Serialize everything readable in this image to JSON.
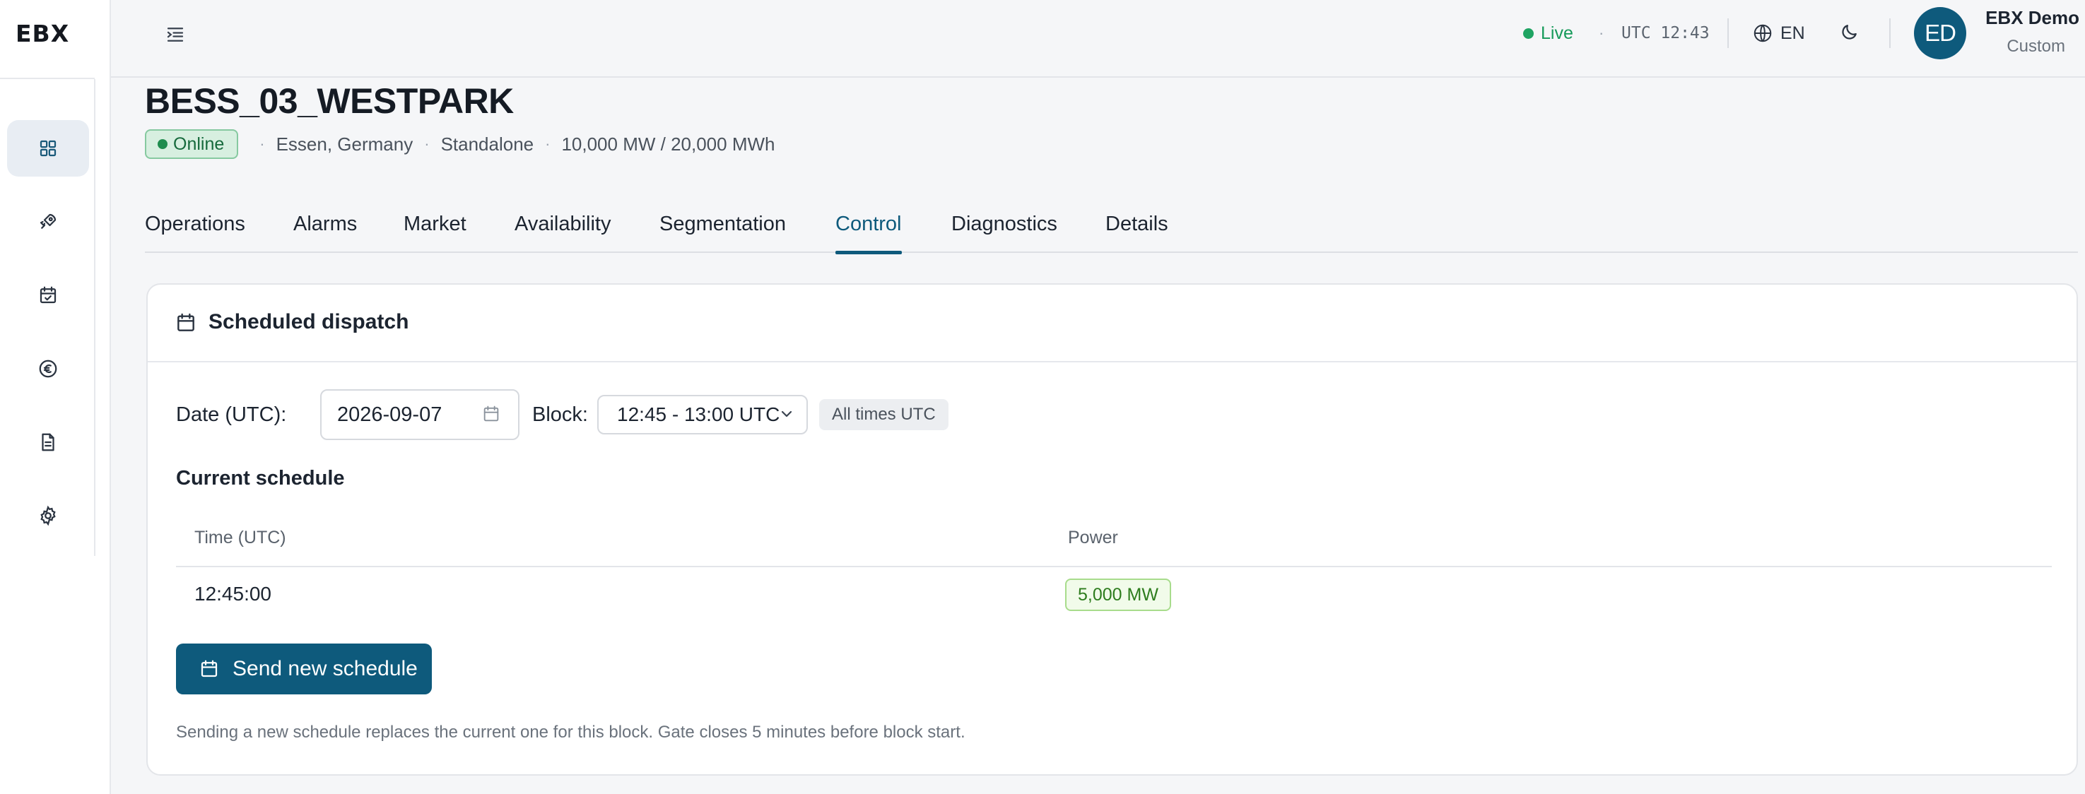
{
  "app": {
    "logo": "EBX",
    "status": {
      "live_label": "Live",
      "clock": "UTC 12:43",
      "color": "#1fa463"
    },
    "language": "EN",
    "user": {
      "initials": "ED",
      "name": "EBX Demo",
      "role": "Custom"
    },
    "accent_color": "#0e5a7c"
  },
  "sidebar": {
    "items": [
      {
        "name": "dashboard",
        "icon": "grid-icon",
        "active": true
      },
      {
        "name": "assets",
        "icon": "rocket-icon",
        "active": false
      },
      {
        "name": "schedule",
        "icon": "calendar-check-icon",
        "active": false
      },
      {
        "name": "finance",
        "icon": "euro-icon",
        "active": false
      },
      {
        "name": "reports",
        "icon": "document-icon",
        "active": false
      },
      {
        "name": "settings",
        "icon": "gear-icon",
        "active": false
      }
    ]
  },
  "asset": {
    "title": "BESS_03_WESTPARK",
    "status": "Online",
    "location": "Essen, Germany",
    "mode": "Standalone",
    "capacity": "10,000 MW / 20,000 MWh"
  },
  "tabs": [
    {
      "label": "Operations",
      "active": false
    },
    {
      "label": "Alarms",
      "active": false
    },
    {
      "label": "Market",
      "active": false
    },
    {
      "label": "Availability",
      "active": false
    },
    {
      "label": "Segmentation",
      "active": false
    },
    {
      "label": "Control",
      "active": true
    },
    {
      "label": "Diagnostics",
      "active": false
    },
    {
      "label": "Details",
      "active": false
    }
  ],
  "dispatch": {
    "title": "Scheduled dispatch",
    "date_label": "Date (UTC):",
    "date_value": "2026-09-07",
    "block_label": "Block:",
    "block_value": "12:45 - 13:00 UTC",
    "utc_tag": "All times UTC",
    "schedule_title": "Current schedule",
    "table": {
      "columns": [
        "Time (UTC)",
        "Power"
      ],
      "rows": [
        {
          "time": "12:45:00",
          "power": "5,000 MW"
        }
      ]
    },
    "send_button": "Send new schedule",
    "hint": "Sending a new schedule replaces the current one for this block. Gate closes 5 minutes before block start."
  }
}
